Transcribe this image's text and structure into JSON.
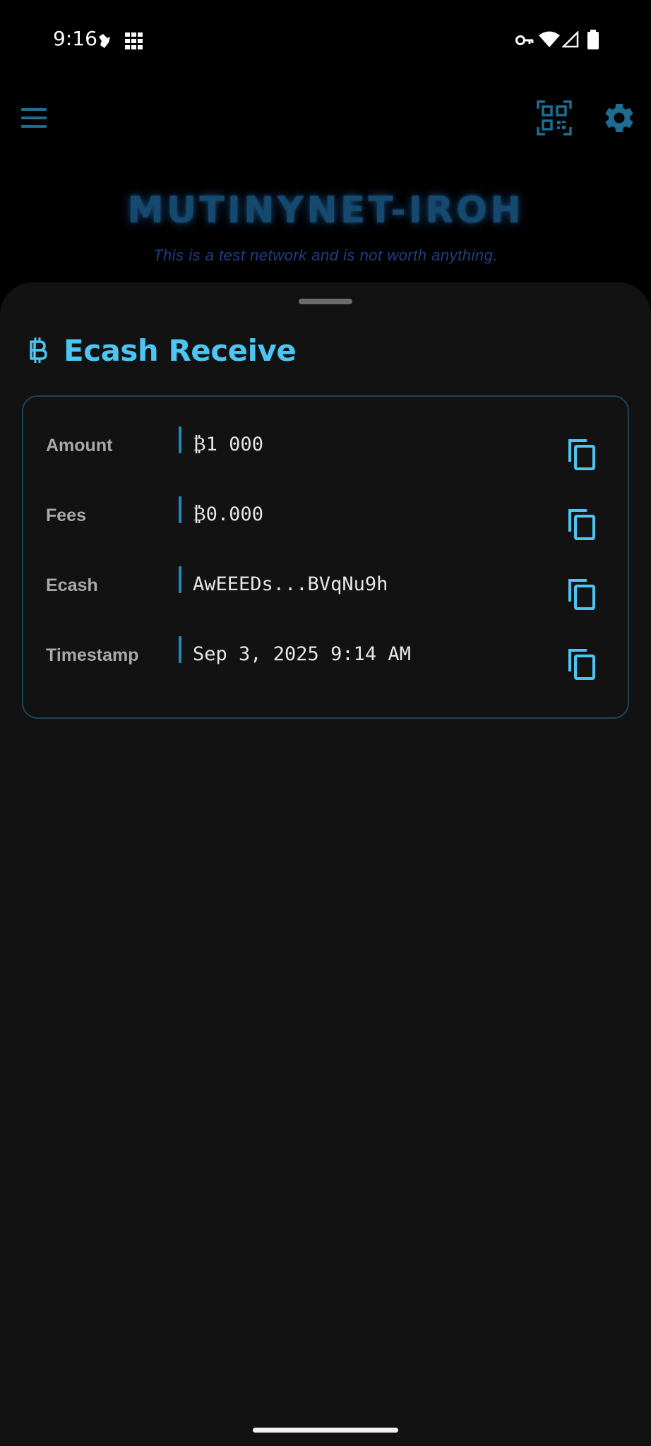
{
  "status_bar": {
    "time": "9:16",
    "icons": [
      "notification-app-icon",
      "grid-app-icon",
      "vpn-key-icon",
      "wifi-icon",
      "cell-signal-icon",
      "battery-icon"
    ]
  },
  "app_bar": {
    "menu_icon": "hamburger-menu-icon",
    "scan_icon": "qr-scan-icon",
    "settings_icon": "gear-icon"
  },
  "network": {
    "title": "MUTINYNET-IROH",
    "subtitle": "This is a test network and is not worth anything."
  },
  "sheet": {
    "icon": "bitcoin-icon",
    "title": "Ecash Receive",
    "rows": [
      {
        "label": "Amount",
        "value": "₿1 000",
        "copy_icon": "copy-icon"
      },
      {
        "label": "Fees",
        "value": "₿0.000",
        "copy_icon": "copy-icon"
      },
      {
        "label": "Ecash",
        "value": "AwEEEDs...BVqNu9h",
        "copy_icon": "copy-icon"
      },
      {
        "label": "Timestamp",
        "value": "Sep 3, 2025 9:14 AM",
        "copy_icon": "copy-icon"
      }
    ]
  },
  "colors": {
    "accent": "#4cc5f2",
    "title_glow": "#16496e",
    "subtitle": "#1d3f84",
    "sheet_bg": "#121212",
    "card_border": "#1d4556",
    "divider": "#2189b8"
  }
}
